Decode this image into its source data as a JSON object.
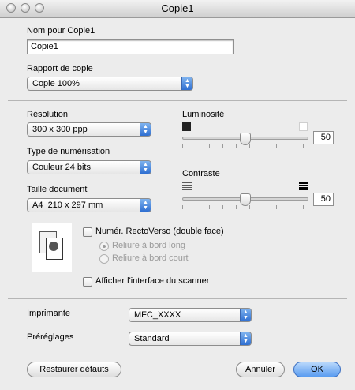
{
  "window": {
    "title": "Copie1"
  },
  "name_section": {
    "label": "Nom pour Copie1",
    "value": "Copie1"
  },
  "copy_ratio": {
    "label": "Rapport de copie",
    "value": "Copie 100%"
  },
  "resolution": {
    "label": "Résolution",
    "value": "300 x 300 ppp"
  },
  "scan_type": {
    "label": "Type de numérisation",
    "value": "Couleur 24 bits"
  },
  "document_size": {
    "label": "Taille document",
    "value": "A4  210 x 297 mm"
  },
  "brightness": {
    "label": "Luminosité",
    "value": "50",
    "level": 0.5
  },
  "contrast": {
    "label": "Contraste",
    "value": "50",
    "level": 0.5
  },
  "duplex": {
    "label": "Numér. RectoVerso (double face)",
    "checked": false,
    "options": [
      "Reliure à bord long",
      "Reliure à bord court"
    ],
    "selected": "Reliure à bord long"
  },
  "show_scanner_ui": {
    "label": "Afficher l'interface du scanner",
    "checked": false
  },
  "printer": {
    "label": "Imprimante",
    "value": "MFC_XXXX"
  },
  "presets": {
    "label": "Préréglages",
    "value": "Standard"
  },
  "buttons": {
    "restore": "Restaurer défauts",
    "cancel": "Annuler",
    "ok": "OK"
  },
  "colors": {
    "accent": "#5a9cf0",
    "window_bg": "#ececec"
  }
}
